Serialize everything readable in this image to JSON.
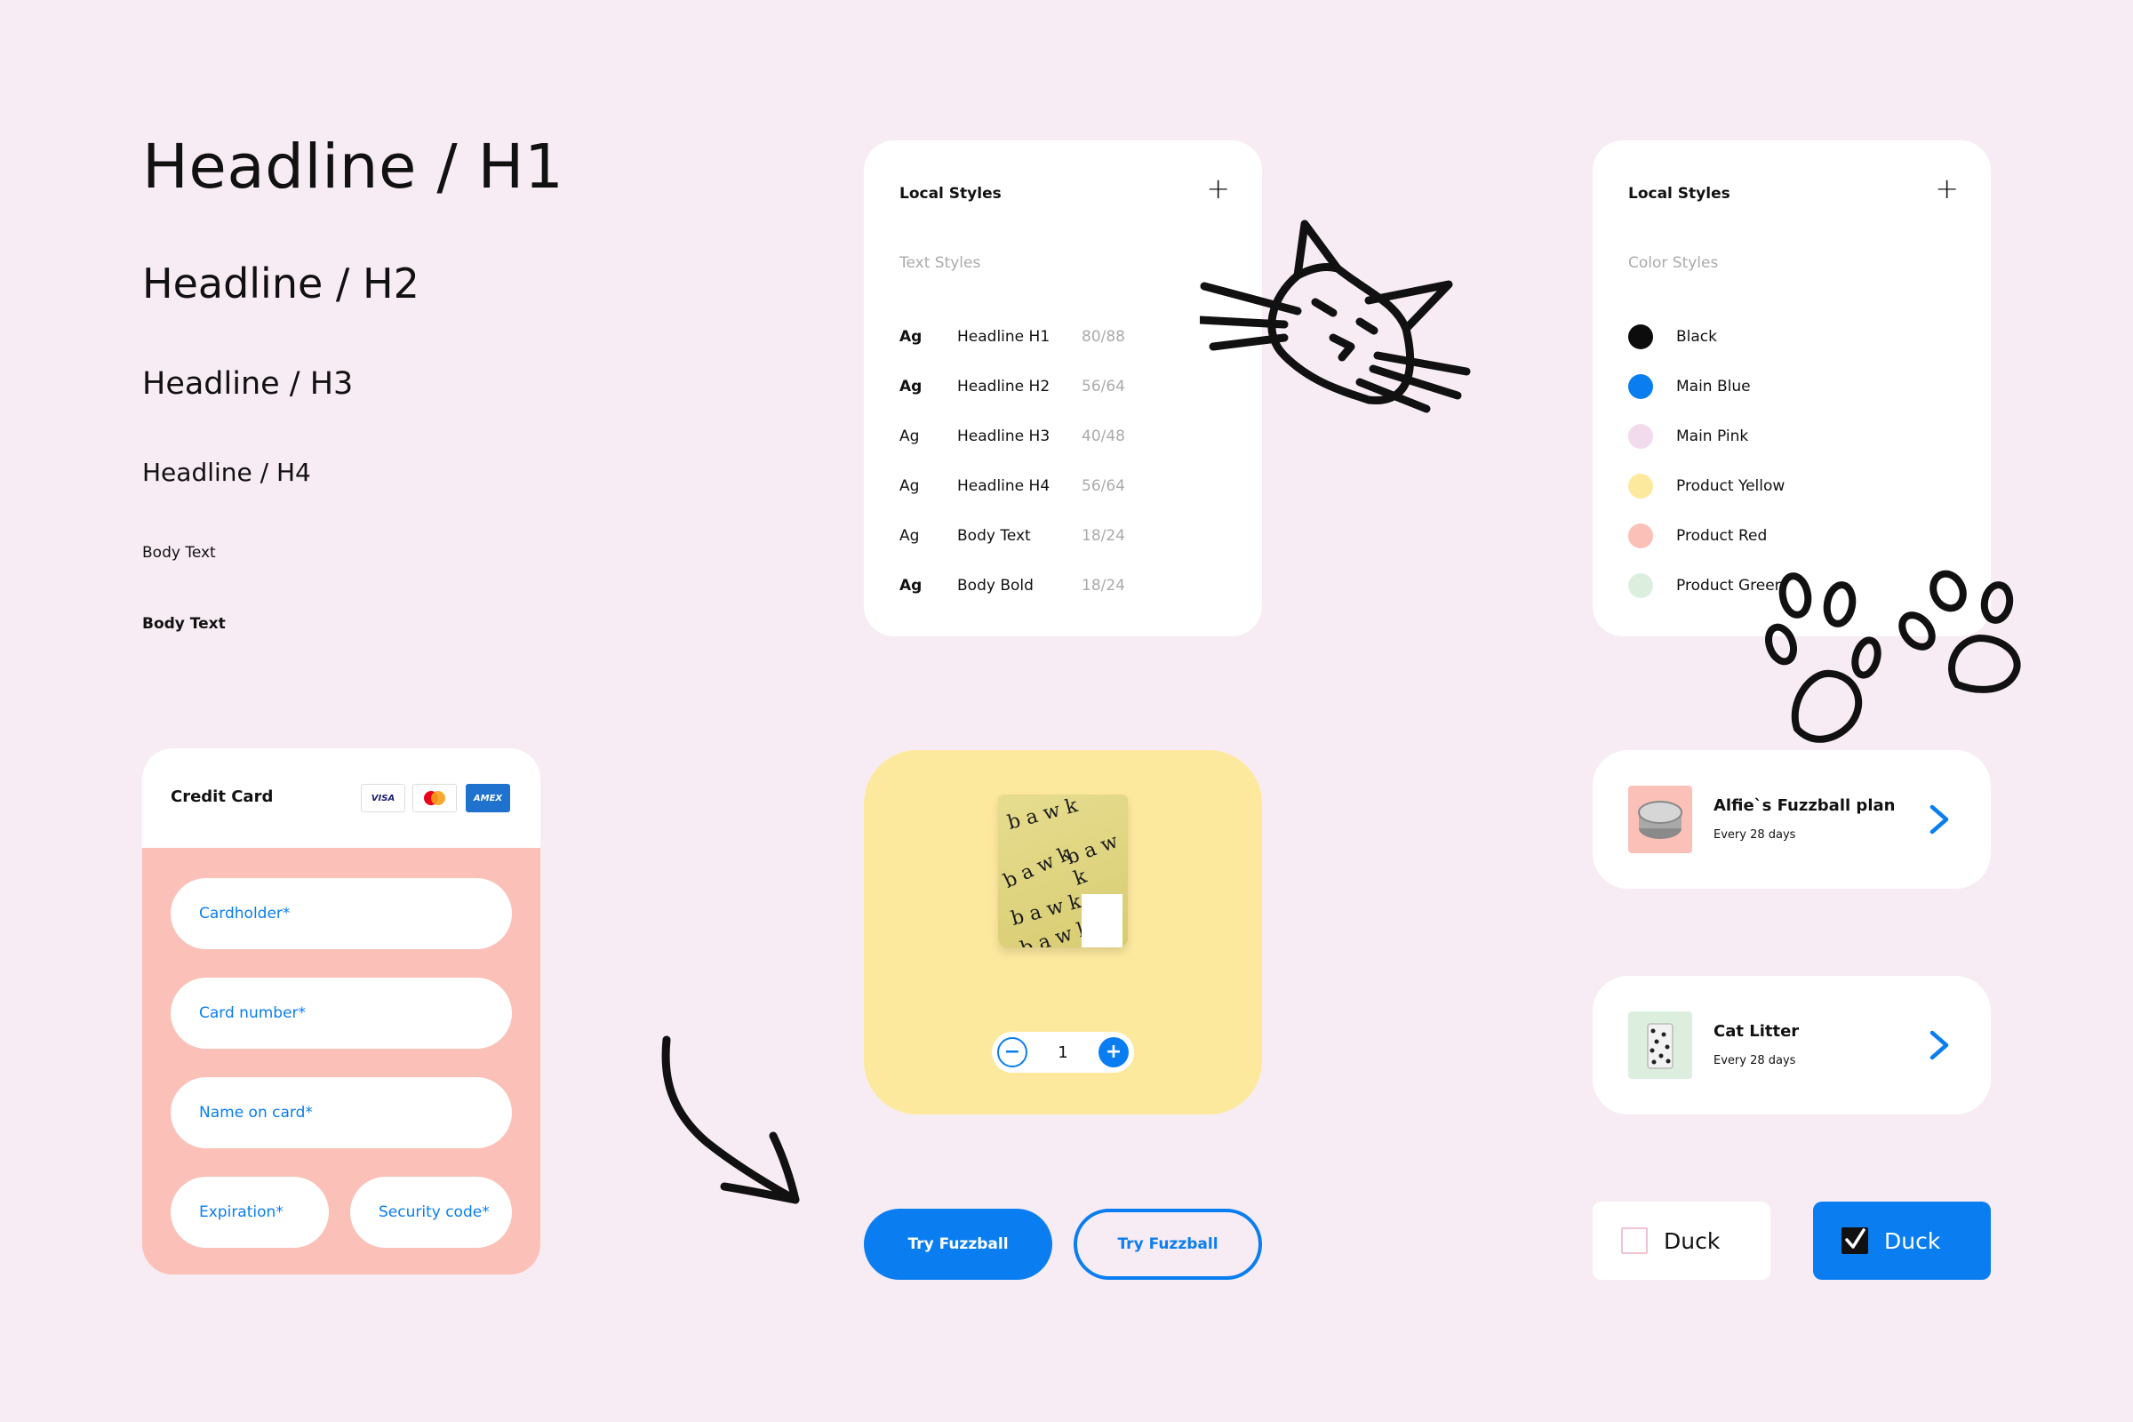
{
  "typography": {
    "h1": "Headline / H1",
    "h2": "Headline / H2",
    "h3": "Headline / H3",
    "h4": "Headline / H4",
    "body": "Body Text",
    "body_bold": "Body Text"
  },
  "text_styles": {
    "title": "Local Styles",
    "plus": "+",
    "subtitle": "Text Styles",
    "items": [
      {
        "ag": "Ag",
        "name": "Headline H1",
        "size": "80/88"
      },
      {
        "ag": "Ag",
        "name": "Headline H2",
        "size": "56/64"
      },
      {
        "ag": "Ag",
        "name": "Headline H3",
        "size": "40/48"
      },
      {
        "ag": "Ag",
        "name": "Headline H4",
        "size": "56/64"
      },
      {
        "ag": "Ag",
        "name": "Body Text",
        "size": "18/24"
      },
      {
        "ag": "Ag",
        "name": "Body Bold",
        "size": "18/24"
      }
    ]
  },
  "color_styles": {
    "title": "Local Styles",
    "plus": "+",
    "subtitle": "Color Styles",
    "items": [
      {
        "name": "Black",
        "color": "#0c0c0c"
      },
      {
        "name": "Main Blue",
        "color": "#0a7ef0"
      },
      {
        "name": "Main Pink",
        "color": "#f3dbee"
      },
      {
        "name": "Product Yellow",
        "color": "#fde99e"
      },
      {
        "name": "Product Red",
        "color": "#fbc0b7"
      },
      {
        "name": "Product Green",
        "color": "#dcefdf"
      }
    ]
  },
  "credit_card": {
    "title": "Credit Card",
    "logos": [
      "VISA",
      "",
      "AMEX"
    ],
    "fields": {
      "cardholder": "Cardholder*",
      "card_number": "Card number*",
      "name_on_card": "Name on card*",
      "expiration": "Expiration*",
      "security_code": "Security code*"
    }
  },
  "product": {
    "quantity": "1",
    "minus": "−",
    "plus": "+",
    "bag_words": [
      "b a w k",
      "b a w k",
      "b a w k",
      "b a w k",
      "b a w k"
    ]
  },
  "buttons": {
    "primary": "Try Fuzzball",
    "secondary": "Try Fuzzball"
  },
  "plans": [
    {
      "title": "Alfie`s Fuzzball plan",
      "subtitle": "Every 28 days"
    },
    {
      "title": "Cat Litter",
      "subtitle": "Every 28 days"
    }
  ],
  "checkboxes": {
    "unchecked_label": "Duck",
    "checked_label": "Duck"
  },
  "colors": {
    "background": "#f8ecf4",
    "accent": "#0a7ef0",
    "product_yellow": "#fde99e",
    "product_red": "#fbc0b7",
    "product_green": "#dcefdf"
  },
  "illustrations": [
    "cat-doodle",
    "paw-prints-doodle",
    "arrow-doodle"
  ]
}
